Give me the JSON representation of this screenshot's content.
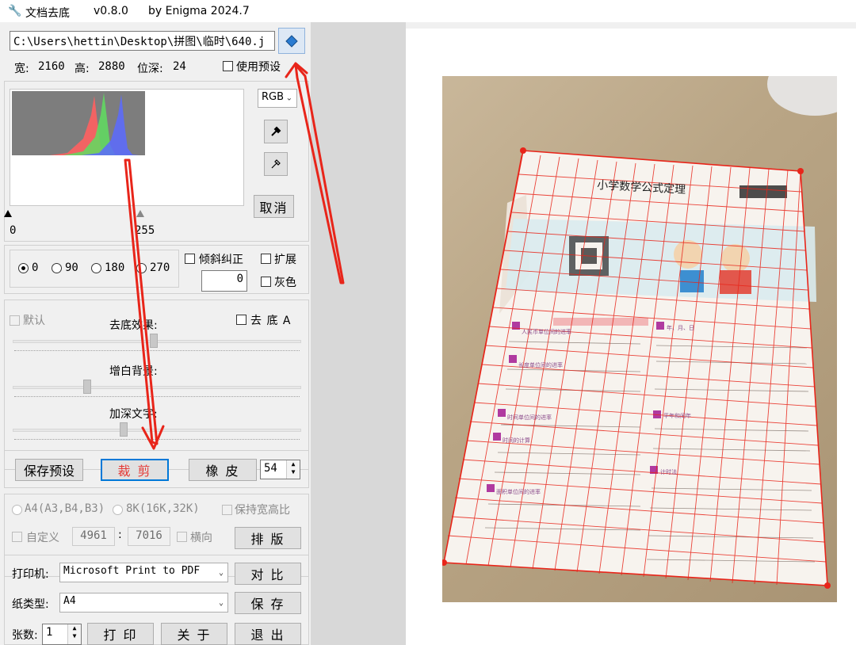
{
  "app": {
    "name": "文档去底",
    "version": "v0.8.0",
    "author": "by Enigma 2024.7"
  },
  "file": {
    "path": "C:\\Users\\hettin\\Desktop\\拼图\\临时\\640.j"
  },
  "info": {
    "width_label": "宽:",
    "width": "2160",
    "height_label": "高:",
    "height": "2880",
    "depth_label": "位深:",
    "depth": "24",
    "use_preset": "使用预设"
  },
  "histogram": {
    "channel": "RGB",
    "min_label": "0",
    "max_label": "255",
    "cancel": "取消"
  },
  "rotate": {
    "options": [
      "0",
      "90",
      "180",
      "270"
    ],
    "selected": "0",
    "deskew": "倾斜纠正",
    "expand": "扩展",
    "angle": "0",
    "gray": "灰色"
  },
  "effects": {
    "default_label": "默认",
    "remove_bg_a": "去 底 A",
    "remove_effect": "去底效果:",
    "whiten_bg": "增白背景:",
    "darken_text": "加深文字:",
    "levels": {
      "remove_effect": 0.49,
      "whiten_bg": 0.25,
      "darken_text": 0.38
    }
  },
  "actions": {
    "save_preset": "保存预设",
    "crop": "裁 剪",
    "eraser": "橡 皮",
    "eraser_size": "54"
  },
  "paper": {
    "a4": "A4(A3,B4,B3)",
    "k8": "8K(16K,32K)",
    "keep_ratio": "保持宽高比",
    "custom": "自定义",
    "custom_w": "4961",
    "sep": ":",
    "custom_h": "7016",
    "landscape": "横向",
    "layout": "排 版"
  },
  "print": {
    "printer_label": "打印机:",
    "printer": "Microsoft Print to PDF",
    "compare": "对 比",
    "paper_label": "纸类型:",
    "paper": "A4",
    "save": "保 存",
    "count_label": "张数:",
    "count": "1",
    "print": "打 印",
    "about": "关 于",
    "exit": "退 出"
  },
  "doc": {
    "title": "小学数学公式定理",
    "sections": [
      "人民币单位间的进率",
      "长度单位间的进率",
      "时间单位间的进率",
      "时间的计算",
      "面积单位间的进率",
      "年、月、日",
      "平年和闰年",
      "计时法"
    ]
  },
  "colors": {
    "accent": "#0078d7",
    "crop_text": "#e53935",
    "annotation": "#e8251a"
  }
}
